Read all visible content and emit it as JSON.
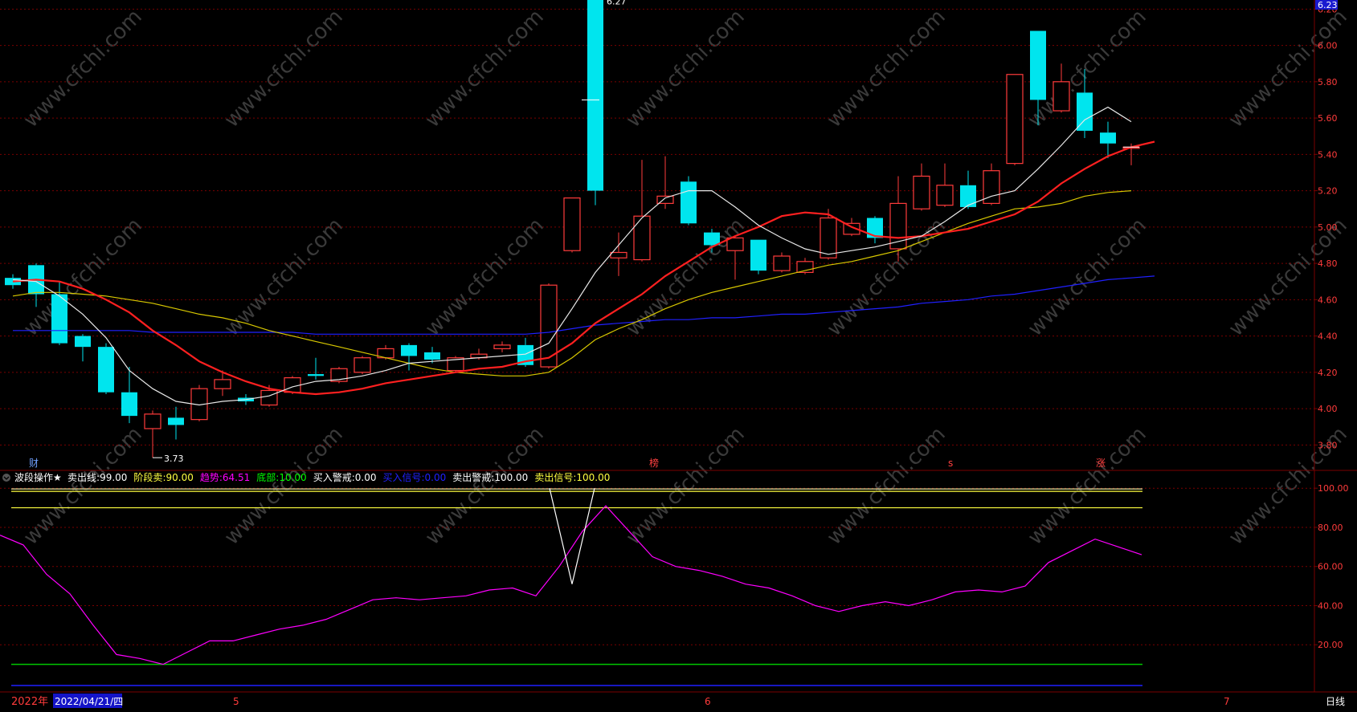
{
  "colors": {
    "background": "#000000",
    "grid": "#7a0000",
    "up": "#ff3b3b",
    "down": "#00e5ee",
    "ma5": "#e8e8e8",
    "ma10": "#ff2020",
    "ma20": "#d8c800",
    "ma60": "#2020ff",
    "osc": "#ff00ff",
    "axis_text": "#ff3b3b",
    "sell_line": "#e8e8a0",
    "stage_sell": "#ffff40",
    "bottom": "#00c800",
    "bottom_blue": "#2020ff",
    "white": "#ffffff"
  },
  "watermark": "www.cfchi.com",
  "indicator_panel": {
    "name": "波段操作★",
    "items": [
      {
        "label": "卖出线",
        "value": "99.00",
        "color": "#ffffff"
      },
      {
        "label": "阶段卖",
        "value": "90.00",
        "color": "#ffff40"
      },
      {
        "label": "趋势",
        "value": "64.51",
        "color": "#ff00ff"
      },
      {
        "label": "底部",
        "value": "10.00",
        "color": "#00ff00"
      },
      {
        "label": "买入警戒",
        "value": "0.00",
        "color": "#ffffff"
      },
      {
        "label": "买入信号",
        "value": "0.00",
        "color": "#2020ff"
      },
      {
        "label": "卖出警戒",
        "value": "100.00",
        "color": "#ffffff"
      },
      {
        "label": "卖出信号",
        "value": "100.00",
        "color": "#ffff40"
      }
    ]
  },
  "bottom_bar": {
    "year": "2022年",
    "date": "2022/04/21/四",
    "month_labels": [
      "5",
      "6",
      "7"
    ],
    "period": "日线"
  },
  "event_markers": [
    "财",
    "榜",
    "s",
    "涨"
  ],
  "top_right_price": "6.23",
  "chart_data": [
    {
      "type": "candlestick",
      "ylim": [
        3.66,
        6.25
      ],
      "y_ticks": [
        "6.20",
        "6.00",
        "5.80",
        "5.60",
        "5.40",
        "5.20",
        "5.00",
        "4.80",
        "4.60",
        "4.40",
        "4.20",
        "4.00",
        "3.80"
      ],
      "candles": [
        {
          "o": 4.72,
          "c": 4.68,
          "h": 4.74,
          "l": 4.66
        },
        {
          "o": 4.79,
          "c": 4.63,
          "h": 4.8,
          "l": 4.56
        },
        {
          "o": 4.63,
          "c": 4.36,
          "h": 4.7,
          "l": 4.35
        },
        {
          "o": 4.4,
          "c": 4.34,
          "h": 4.41,
          "l": 4.26
        },
        {
          "o": 4.34,
          "c": 4.09,
          "h": 4.36,
          "l": 4.08
        },
        {
          "o": 4.09,
          "c": 3.96,
          "h": 4.23,
          "l": 3.92
        },
        {
          "o": 3.89,
          "c": 3.97,
          "h": 3.99,
          "l": 3.73
        },
        {
          "o": 3.95,
          "c": 3.91,
          "h": 4.01,
          "l": 3.83
        },
        {
          "o": 3.94,
          "c": 4.11,
          "h": 4.13,
          "l": 3.93
        },
        {
          "o": 4.11,
          "c": 4.16,
          "h": 4.21,
          "l": 4.07
        },
        {
          "o": 4.06,
          "c": 4.04,
          "h": 4.08,
          "l": 4.02
        },
        {
          "o": 4.02,
          "c": 4.1,
          "h": 4.13,
          "l": 4.01
        },
        {
          "o": 4.09,
          "c": 4.17,
          "h": 4.18,
          "l": 4.08
        },
        {
          "o": 4.19,
          "c": 4.18,
          "h": 4.28,
          "l": 4.16
        },
        {
          "o": 4.15,
          "c": 4.22,
          "h": 4.23,
          "l": 4.14
        },
        {
          "o": 4.2,
          "c": 4.28,
          "h": 4.29,
          "l": 4.19
        },
        {
          "o": 4.28,
          "c": 4.33,
          "h": 4.35,
          "l": 4.27
        },
        {
          "o": 4.35,
          "c": 4.29,
          "h": 4.36,
          "l": 4.21
        },
        {
          "o": 4.31,
          "c": 4.27,
          "h": 4.34,
          "l": 4.25
        },
        {
          "o": 4.21,
          "c": 4.28,
          "h": 4.29,
          "l": 4.2
        },
        {
          "o": 4.28,
          "c": 4.3,
          "h": 4.33,
          "l": 4.27
        },
        {
          "o": 4.33,
          "c": 4.35,
          "h": 4.37,
          "l": 4.31
        },
        {
          "o": 4.35,
          "c": 4.24,
          "h": 4.39,
          "l": 4.23
        },
        {
          "o": 4.23,
          "c": 4.68,
          "h": 4.69,
          "l": 4.22
        },
        {
          "o": 4.87,
          "c": 5.16,
          "h": 5.16,
          "l": 4.86
        },
        {
          "o": 6.27,
          "c": 5.2,
          "h": 6.27,
          "l": 5.12
        },
        {
          "o": 4.83,
          "c": 4.86,
          "h": 4.97,
          "l": 4.73
        },
        {
          "o": 4.82,
          "c": 5.06,
          "h": 5.37,
          "l": 4.81
        },
        {
          "o": 5.13,
          "c": 5.17,
          "h": 5.39,
          "l": 5.1
        },
        {
          "o": 5.25,
          "c": 5.02,
          "h": 5.28,
          "l": 5.01
        },
        {
          "o": 4.97,
          "c": 4.9,
          "h": 4.99,
          "l": 4.86
        },
        {
          "o": 4.87,
          "c": 4.94,
          "h": 4.95,
          "l": 4.71
        },
        {
          "o": 4.93,
          "c": 4.76,
          "h": 4.93,
          "l": 4.74
        },
        {
          "o": 4.76,
          "c": 4.84,
          "h": 4.86,
          "l": 4.75
        },
        {
          "o": 4.75,
          "c": 4.81,
          "h": 4.83,
          "l": 4.74
        },
        {
          "o": 4.83,
          "c": 5.05,
          "h": 5.1,
          "l": 4.82
        },
        {
          "o": 4.96,
          "c": 5.02,
          "h": 5.05,
          "l": 4.95
        },
        {
          "o": 5.05,
          "c": 4.94,
          "h": 5.06,
          "l": 4.91
        },
        {
          "o": 4.88,
          "c": 5.13,
          "h": 5.28,
          "l": 4.81
        },
        {
          "o": 5.1,
          "c": 5.28,
          "h": 5.35,
          "l": 5.09
        },
        {
          "o": 5.12,
          "c": 5.23,
          "h": 5.35,
          "l": 5.11
        },
        {
          "o": 5.23,
          "c": 5.11,
          "h": 5.31,
          "l": 5.1
        },
        {
          "o": 5.13,
          "c": 5.31,
          "h": 5.35,
          "l": 5.12
        },
        {
          "o": 5.35,
          "c": 5.84,
          "h": 5.84,
          "l": 5.34
        },
        {
          "o": 6.08,
          "c": 5.7,
          "h": 6.08,
          "l": 5.56
        },
        {
          "o": 5.64,
          "c": 5.8,
          "h": 5.9,
          "l": 5.63
        },
        {
          "o": 5.74,
          "c": 5.53,
          "h": 5.87,
          "l": 5.49
        },
        {
          "o": 5.52,
          "c": 5.46,
          "h": 5.58,
          "l": 5.38
        },
        {
          "o": 5.44,
          "c": 5.44,
          "h": 5.46,
          "l": 5.34
        }
      ],
      "ma5": [
        4.71,
        4.7,
        4.62,
        4.52,
        4.39,
        4.21,
        4.11,
        4.04,
        4.02,
        4.04,
        4.05,
        4.07,
        4.12,
        4.15,
        4.16,
        4.18,
        4.21,
        4.25,
        4.26,
        4.27,
        4.28,
        4.29,
        4.3,
        4.36,
        4.55,
        4.75,
        4.9,
        5.05,
        5.16,
        5.2,
        5.2,
        5.11,
        5.01,
        4.94,
        4.88,
        4.85,
        4.87,
        4.89,
        4.92,
        4.95,
        5.03,
        5.12,
        5.17,
        5.2,
        5.32,
        5.45,
        5.59,
        5.66,
        5.58
      ],
      "ma10": [
        4.7,
        4.71,
        4.7,
        4.66,
        4.6,
        4.53,
        4.43,
        4.35,
        4.26,
        4.2,
        4.15,
        4.11,
        4.09,
        4.08,
        4.09,
        4.11,
        4.14,
        4.16,
        4.18,
        4.2,
        4.22,
        4.23,
        4.26,
        4.28,
        4.36,
        4.47,
        4.55,
        4.63,
        4.73,
        4.81,
        4.89,
        4.95,
        5.0,
        5.06,
        5.08,
        5.07,
        5.0,
        4.95,
        4.94,
        4.95,
        4.97,
        4.99,
        5.03,
        5.07,
        5.14,
        5.24,
        5.32,
        5.39,
        5.44,
        5.47
      ],
      "ma20": [
        4.62,
        4.64,
        4.64,
        4.63,
        4.62,
        4.6,
        4.58,
        4.55,
        4.52,
        4.5,
        4.47,
        4.43,
        4.4,
        4.37,
        4.34,
        4.31,
        4.28,
        4.25,
        4.22,
        4.2,
        4.19,
        4.18,
        4.18,
        4.2,
        4.28,
        4.38,
        4.44,
        4.49,
        4.55,
        4.6,
        4.64,
        4.67,
        4.7,
        4.73,
        4.76,
        4.79,
        4.81,
        4.84,
        4.87,
        4.92,
        4.97,
        5.02,
        5.06,
        5.1,
        5.11,
        5.13,
        5.17,
        5.19,
        5.2
      ],
      "ma60": [
        4.43,
        4.43,
        4.43,
        4.43,
        4.43,
        4.43,
        4.42,
        4.42,
        4.42,
        4.42,
        4.42,
        4.42,
        4.42,
        4.41,
        4.41,
        4.41,
        4.41,
        4.41,
        4.41,
        4.41,
        4.41,
        4.41,
        4.41,
        4.42,
        4.44,
        4.46,
        4.47,
        4.48,
        4.49,
        4.49,
        4.5,
        4.5,
        4.51,
        4.52,
        4.52,
        4.53,
        4.54,
        4.55,
        4.56,
        4.58,
        4.59,
        4.6,
        4.62,
        4.63,
        4.65,
        4.67,
        4.69,
        4.71,
        4.72,
        4.73
      ],
      "annotations": [
        {
          "label": "6.27",
          "candle": 25,
          "value": 6.27
        },
        {
          "label": "3.73",
          "candle": 6,
          "value": 3.73
        }
      ]
    },
    {
      "type": "line",
      "ylim": [
        0,
        105
      ],
      "y_ticks": [
        "100.00",
        "80.00",
        "60.00",
        "40.00",
        "20.00"
      ],
      "trend": [
        76,
        71,
        56,
        46,
        30,
        15,
        13,
        10,
        16,
        22,
        22,
        25,
        28,
        30,
        33,
        38,
        43,
        44,
        43,
        44,
        45,
        48,
        49,
        45,
        60,
        78,
        91,
        78,
        65,
        60,
        58,
        55,
        51,
        49,
        45,
        40,
        37,
        40,
        42,
        40,
        43,
        47,
        48,
        47,
        50,
        62,
        68,
        74,
        70,
        66,
        64
      ],
      "sell_line": 99,
      "stage_sell": 90,
      "bottom": 10,
      "spike": {
        "candle": 25,
        "top": 100,
        "bottom": 51
      }
    }
  ]
}
